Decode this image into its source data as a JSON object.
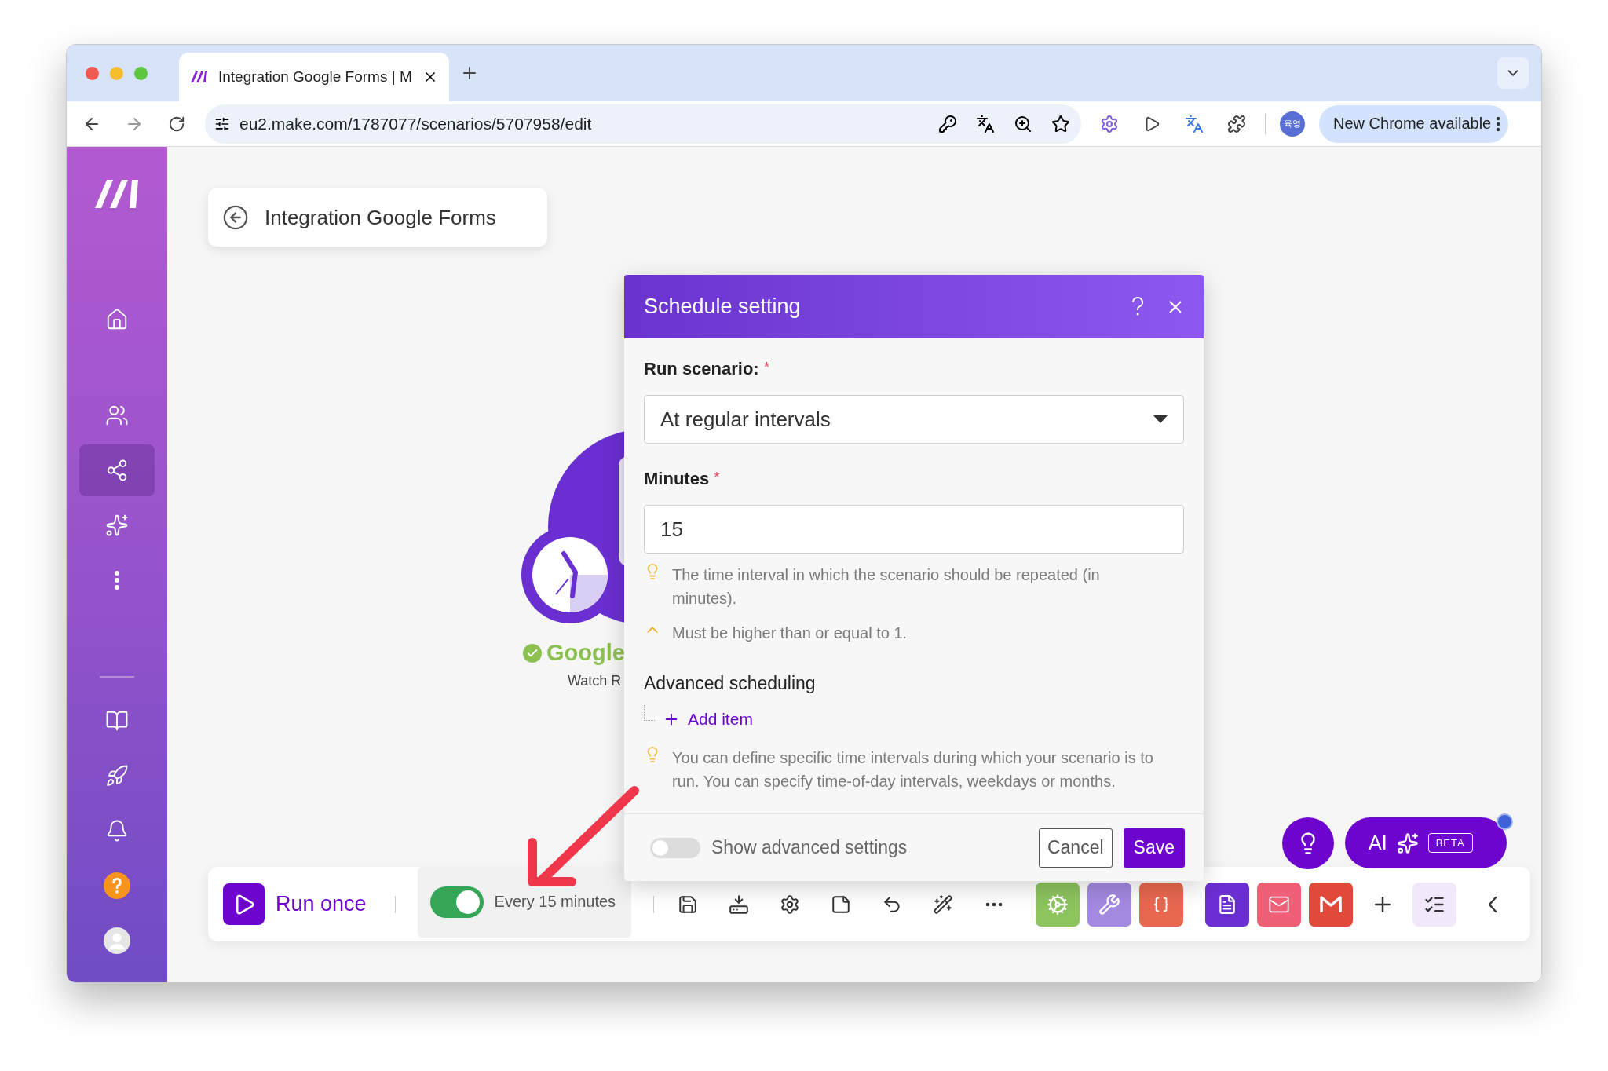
{
  "browser": {
    "tab_title": "Integration Google Forms | M",
    "url": "eu2.make.com/1787077/scenarios/5707958/edit",
    "profile": "육영",
    "update_button": "New Chrome available"
  },
  "sidebar": {
    "groups": [
      [
        {
          "kind": "home",
          "selected": false
        }
      ],
      [
        {
          "kind": "team",
          "selected": false
        },
        {
          "kind": "scenarios",
          "selected": true
        },
        {
          "kind": "ai",
          "selected": false
        },
        {
          "kind": "more",
          "selected": false
        }
      ],
      [
        {
          "kind": "docs",
          "selected": false
        },
        {
          "kind": "launch",
          "selected": false
        },
        {
          "kind": "notifications",
          "selected": false
        },
        {
          "kind": "help",
          "selected": false
        },
        {
          "kind": "avatar",
          "selected": false
        }
      ]
    ]
  },
  "scenario": {
    "title": "Integration Google Forms"
  },
  "module": {
    "app": "Google",
    "action": "Watch R",
    "ok": true
  },
  "dialog": {
    "title": "Schedule setting",
    "run_label": "Run scenario:",
    "run_mark": "*",
    "run_value": "At regular intervals",
    "minutes_label": "Minutes",
    "minutes_mark": "*",
    "minutes_value": "15",
    "minutes_hint": "The time interval in which the scenario should be repeated (in minutes).",
    "minutes_rule": "Must be higher than or equal to 1.",
    "advanced_title": "Advanced scheduling",
    "add_item": "Add item",
    "advanced_hint": "You can define specific time intervals during which your scenario is to run. You can specify time-of-day intervals, weekdays or months.",
    "advanced_toggle": {
      "label": "Show advanced settings",
      "on": false
    },
    "buttons": [
      "Cancel",
      "Save"
    ]
  },
  "toolbar": {
    "run_label": "Run once",
    "schedule": {
      "label": "Every 15 minutes",
      "on": true
    },
    "tools": [
      {
        "kind": "save"
      },
      {
        "kind": "export"
      },
      {
        "kind": "settings"
      },
      {
        "kind": "note"
      },
      {
        "kind": "undo"
      },
      {
        "kind": "magic"
      },
      {
        "kind": "more"
      }
    ],
    "apps": [
      {
        "kind": "gear",
        "color": "#8dc45e"
      },
      {
        "kind": "tools",
        "color": "#a389df"
      },
      {
        "kind": "brackets",
        "color": "#e8684f"
      }
    ],
    "modules": [
      {
        "kind": "forms",
        "color": "#6a2fd1"
      },
      {
        "kind": "mail",
        "color": "#ef5f75"
      },
      {
        "kind": "gmail",
        "color": "#e14a3b"
      }
    ]
  },
  "assistant": {
    "label": "AI",
    "badge": "BETA",
    "notification": true
  }
}
